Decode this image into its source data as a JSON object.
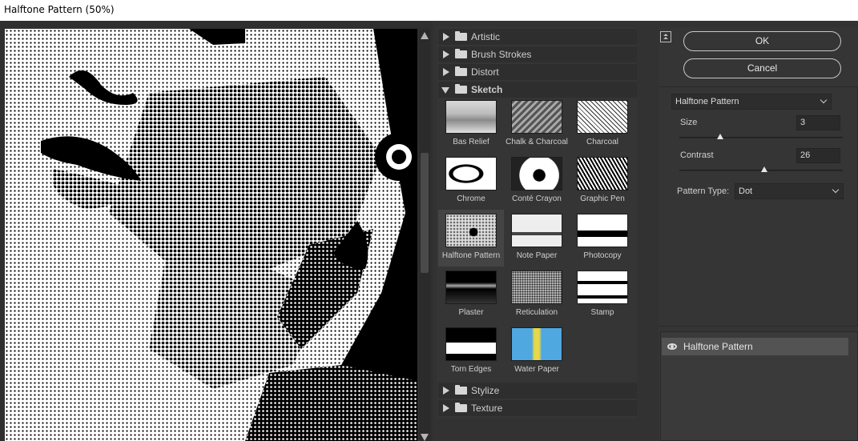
{
  "window": {
    "title": "Halftone Pattern (50%)"
  },
  "categories": [
    {
      "label": "Artistic",
      "expanded": false
    },
    {
      "label": "Brush Strokes",
      "expanded": false
    },
    {
      "label": "Distort",
      "expanded": false
    },
    {
      "label": "Sketch",
      "expanded": true
    },
    {
      "label": "Stylize",
      "expanded": false
    },
    {
      "label": "Texture",
      "expanded": false
    }
  ],
  "sketch_filters": [
    {
      "label": "Bas Relief"
    },
    {
      "label": "Chalk & Charcoal"
    },
    {
      "label": "Charcoal"
    },
    {
      "label": "Chrome"
    },
    {
      "label": "Conté Crayon"
    },
    {
      "label": "Graphic Pen"
    },
    {
      "label": "Halftone Pattern",
      "selected": true
    },
    {
      "label": "Note Paper"
    },
    {
      "label": "Photocopy"
    },
    {
      "label": "Plaster"
    },
    {
      "label": "Reticulation"
    },
    {
      "label": "Stamp"
    },
    {
      "label": "Torn Edges"
    },
    {
      "label": "Water Paper"
    }
  ],
  "buttons": {
    "ok": "OK",
    "cancel": "Cancel"
  },
  "settings": {
    "filter_name": "Halftone Pattern",
    "size_label": "Size",
    "size_value": "3",
    "size_fraction": 0.25,
    "contrast_label": "Contrast",
    "contrast_value": "26",
    "contrast_fraction": 0.52,
    "pattern_type_label": "Pattern Type:",
    "pattern_type_value": "Dot"
  },
  "layers": {
    "active_layer": "Halftone Pattern"
  },
  "colors": {
    "panel": "#353535",
    "selected_thumb": "#444444",
    "layer_row": "#535353"
  }
}
